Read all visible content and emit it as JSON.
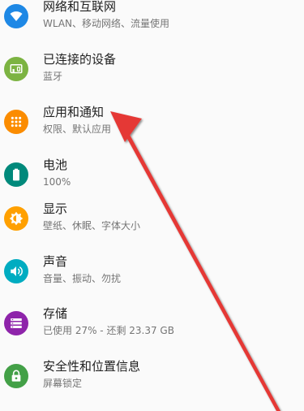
{
  "settings": {
    "items": [
      {
        "title": "网络和互联网",
        "subtitle": "WLAN、移动网络、流量使用",
        "icon": "wifi-icon",
        "color": "#1e88e5"
      },
      {
        "title": "已连接的设备",
        "subtitle": "蓝牙",
        "icon": "connected-devices-icon",
        "color": "#7cb342"
      },
      {
        "title": "应用和通知",
        "subtitle": "权限、默认应用",
        "icon": "apps-grid-icon",
        "color": "#fb8c00"
      },
      {
        "title": "电池",
        "subtitle": "100%",
        "icon": "battery-icon",
        "color": "#00897b"
      },
      {
        "title": "显示",
        "subtitle": "壁纸、休眠、字体大小",
        "icon": "brightness-icon",
        "color": "#ffa000"
      },
      {
        "title": "声音",
        "subtitle": "音量、振动、勿扰",
        "icon": "volume-icon",
        "color": "#00acc1"
      },
      {
        "title": "存储",
        "subtitle": "已使用 27% - 还剩 23.37 GB",
        "icon": "storage-icon",
        "color": "#8e24aa"
      },
      {
        "title": "安全性和位置信息",
        "subtitle": "屏幕锁定",
        "icon": "lock-icon",
        "color": "#43a047"
      }
    ]
  },
  "annotation": {
    "color": "#e53935"
  }
}
